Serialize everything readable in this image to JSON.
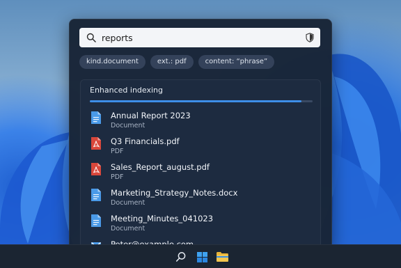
{
  "search": {
    "query": "reports"
  },
  "filters": [
    {
      "label": "kind.document"
    },
    {
      "label": "ext.: pdf"
    },
    {
      "label": "content: “phrase”"
    }
  ],
  "indexing": {
    "label": "Enhanced indexing",
    "progress_percent": 95
  },
  "results": [
    {
      "name": "Annual Report 2023",
      "type": "Document",
      "icon": "document-icon"
    },
    {
      "name": "Q3 Financials.pdf",
      "type": "PDF",
      "icon": "pdf-icon"
    },
    {
      "name": "Sales_Report_august.pdf",
      "type": "PDF",
      "icon": "pdf-icon"
    },
    {
      "name": "Marketing_Strategy_Notes.docx",
      "type": "Document",
      "icon": "document-icon"
    },
    {
      "name": "Meeting_Minutes_041023",
      "type": "Document",
      "icon": "document-icon"
    },
    {
      "name": "Peter@example.com",
      "type": "",
      "icon": "mail-icon"
    }
  ],
  "taskbar": {
    "items": [
      {
        "icon": "search-icon"
      },
      {
        "icon": "windows-start-icon"
      },
      {
        "icon": "file-explorer-icon"
      }
    ]
  },
  "colors": {
    "panel": "#182436",
    "accent": "#3d8ee8",
    "pdf": "#d9473b",
    "document": "#4a9ae8"
  }
}
